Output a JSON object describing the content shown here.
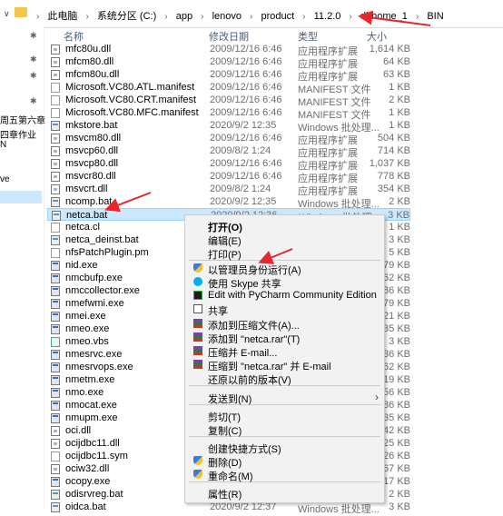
{
  "address": {
    "breadcrumbs": [
      "此电脑",
      "系统分区 (C:)",
      "app",
      "lenovo",
      "product",
      "11.2.0",
      "dbhome_1",
      "BIN"
    ],
    "separator": "›",
    "dropdown": "∨"
  },
  "sidebar": {
    "items": [
      "周五第六章",
      "四章作业",
      "N",
      "ve"
    ]
  },
  "columns": {
    "name": "名称",
    "date": "修改日期",
    "type": "类型",
    "size": "大小"
  },
  "files": [
    {
      "icon": "dll",
      "name": "mfc80u.dll",
      "date": "2009/12/16 6:46",
      "type": "应用程序扩展",
      "size": "1,614 KB"
    },
    {
      "icon": "dll",
      "name": "mfcm80.dll",
      "date": "2009/12/16 6:46",
      "type": "应用程序扩展",
      "size": "64 KB"
    },
    {
      "icon": "dll",
      "name": "mfcm80u.dll",
      "date": "2009/12/16 6:46",
      "type": "应用程序扩展",
      "size": "63 KB"
    },
    {
      "icon": "manifest",
      "name": "Microsoft.VC80.ATL.manifest",
      "date": "2009/12/16 6:46",
      "type": "MANIFEST 文件",
      "size": "1 KB"
    },
    {
      "icon": "manifest",
      "name": "Microsoft.VC80.CRT.manifest",
      "date": "2009/12/16 6:46",
      "type": "MANIFEST 文件",
      "size": "2 KB"
    },
    {
      "icon": "manifest",
      "name": "Microsoft.VC80.MFC.manifest",
      "date": "2009/12/16 6:46",
      "type": "MANIFEST 文件",
      "size": "1 KB"
    },
    {
      "icon": "bat",
      "name": "mkstore.bat",
      "date": "2020/9/2 12:35",
      "type": "Windows 批处理...",
      "size": "1 KB"
    },
    {
      "icon": "dll",
      "name": "msvcm80.dll",
      "date": "2009/12/16 6:46",
      "type": "应用程序扩展",
      "size": "504 KB"
    },
    {
      "icon": "dll",
      "name": "msvcp60.dll",
      "date": "2009/8/2 1:24",
      "type": "应用程序扩展",
      "size": "714 KB"
    },
    {
      "icon": "dll",
      "name": "msvcp80.dll",
      "date": "2009/12/16 6:46",
      "type": "应用程序扩展",
      "size": "1,037 KB"
    },
    {
      "icon": "dll",
      "name": "msvcr80.dll",
      "date": "2009/12/16 6:46",
      "type": "应用程序扩展",
      "size": "778 KB"
    },
    {
      "icon": "dll",
      "name": "msvcrt.dll",
      "date": "2009/8/2 1:24",
      "type": "应用程序扩展",
      "size": "354 KB"
    },
    {
      "icon": "bat",
      "name": "ncomp.bat",
      "date": "2020/9/2 12:35",
      "type": "Windows 批处理...",
      "size": "2 KB"
    },
    {
      "icon": "bat",
      "name": "netca.bat",
      "date": "2020/9/2 12:36",
      "type": "Windows 批处理...",
      "size": "3 KB",
      "selected": true
    },
    {
      "icon": "generic",
      "name": "netca.cl",
      "date": "",
      "type": "",
      "size": "1 KB"
    },
    {
      "icon": "bat",
      "name": "netca_deinst.bat",
      "date": "",
      "type": "",
      "size": "3 KB"
    },
    {
      "icon": "generic",
      "name": "nfsPatchPlugin.pm",
      "date": "",
      "type": "",
      "size": "5 KB"
    },
    {
      "icon": "exe",
      "name": "nid.exe",
      "date": "",
      "type": "",
      "size": "79 KB"
    },
    {
      "icon": "exe",
      "name": "nmcbufp.exe",
      "date": "",
      "type": "",
      "size": "62 KB"
    },
    {
      "icon": "exe",
      "name": "nmccollector.exe",
      "date": "",
      "type": "",
      "size": "86 KB"
    },
    {
      "icon": "exe",
      "name": "nmefwmi.exe",
      "date": "",
      "type": "",
      "size": "479 KB"
    },
    {
      "icon": "exe",
      "name": "nmei.exe",
      "date": "",
      "type": "",
      "size": "21 KB"
    },
    {
      "icon": "exe",
      "name": "nmeo.exe",
      "date": "",
      "type": "",
      "size": "135 KB"
    },
    {
      "icon": "vbs",
      "name": "nmeo.vbs",
      "date": "",
      "type": "",
      "size": "3 KB"
    },
    {
      "icon": "exe",
      "name": "nmesrvc.exe",
      "date": "",
      "type": "",
      "size": "36 KB"
    },
    {
      "icon": "exe",
      "name": "nmesrvops.exe",
      "date": "",
      "type": "",
      "size": "62 KB"
    },
    {
      "icon": "exe",
      "name": "nmetm.exe",
      "date": "",
      "type": "",
      "size": "19 KB"
    },
    {
      "icon": "exe",
      "name": "nmo.exe",
      "date": "",
      "type": "",
      "size": "56 KB"
    },
    {
      "icon": "exe",
      "name": "nmocat.exe",
      "date": "",
      "type": "",
      "size": "86 KB"
    },
    {
      "icon": "exe",
      "name": "nmupm.exe",
      "date": "",
      "type": "",
      "size": "135 KB"
    },
    {
      "icon": "dll",
      "name": "oci.dll",
      "date": "",
      "type": "",
      "size": "642 KB"
    },
    {
      "icon": "dll",
      "name": "ocijdbc11.dll",
      "date": "",
      "type": "",
      "size": "25 KB"
    },
    {
      "icon": "generic",
      "name": "ocijdbc11.sym",
      "date": "",
      "type": "",
      "size": "26 KB"
    },
    {
      "icon": "dll",
      "name": "ociw32.dll",
      "date": "",
      "type": "",
      "size": "467 KB"
    },
    {
      "icon": "exe",
      "name": "ocopy.exe",
      "date": "",
      "type": "",
      "size": "17 KB"
    },
    {
      "icon": "bat",
      "name": "odisrvreg.bat",
      "date": "",
      "type": "",
      "size": "2 KB"
    },
    {
      "icon": "bat",
      "name": "oidca.bat",
      "date": "2020/9/2 12:37",
      "type": "Windows 批处理...",
      "size": "3 KB"
    }
  ],
  "context_menu": {
    "items": [
      {
        "label": "打开(O)",
        "bold": true,
        "icon": "none"
      },
      {
        "label": "编辑(E)",
        "icon": "none"
      },
      {
        "label": "打印(P)",
        "icon": "none"
      },
      {
        "label": "以管理员身份运行(A)",
        "icon": "shield"
      },
      {
        "label": "使用 Skype 共享",
        "icon": "skype"
      },
      {
        "label": "Edit with PyCharm Community Edition",
        "icon": "pycharm"
      },
      {
        "label": "共享",
        "icon": "share"
      },
      {
        "label": "添加到压缩文件(A)...",
        "icon": "rar"
      },
      {
        "label": "添加到 \"netca.rar\"(T)",
        "icon": "rar"
      },
      {
        "label": "压缩并 E-mail...",
        "icon": "rar"
      },
      {
        "label": "压缩到 \"netca.rar\" 并 E-mail",
        "icon": "rar"
      },
      {
        "label": "还原以前的版本(V)",
        "icon": "none"
      },
      {
        "label": "发送到(N)",
        "icon": "none",
        "submenu": true
      },
      {
        "label": "剪切(T)",
        "icon": "none"
      },
      {
        "label": "复制(C)",
        "icon": "none"
      },
      {
        "label": "创建快捷方式(S)",
        "icon": "none"
      },
      {
        "label": "删除(D)",
        "icon": "shield"
      },
      {
        "label": "重命名(M)",
        "icon": "shield"
      },
      {
        "label": "属性(R)",
        "icon": "none"
      }
    ],
    "submenu_arrow": "›"
  },
  "annotation_color": "#e8262b"
}
